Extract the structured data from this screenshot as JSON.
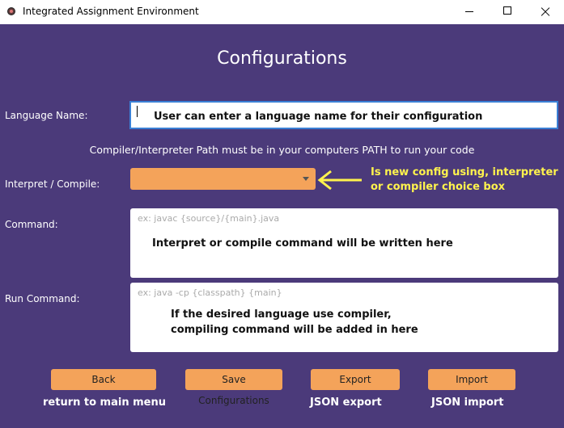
{
  "window": {
    "title": "Integrated Assignment Environment"
  },
  "page": {
    "heading": "Configurations",
    "path_note": "Compiler/Interpreter Path must be in your computers PATH to run your code"
  },
  "labels": {
    "language_name": "Language Name:",
    "interpret_compile": "Interpret / Compile:",
    "command": "Command:",
    "run_command": "Run Command:"
  },
  "fields": {
    "language_name_value": "",
    "interpret_compile_selected": "",
    "command_placeholder": "ex: javac {source}/{main}.java",
    "run_command_placeholder": "ex: java -cp {classpath} {main}"
  },
  "buttons": {
    "back": "Back",
    "save": "Save Configurations",
    "export": "Export",
    "import": "Import"
  },
  "annotations": {
    "language_name": "User can enter a language name for their configuration",
    "interpret_compile": "Is new config using, interpreter\nor compiler choice box",
    "command": "Interpret or compile command will be written here",
    "run_command": "If the desired language use compiler,\ncompiling command will be added in here",
    "back": "return to main menu",
    "export": "JSON export",
    "import": "JSON import"
  },
  "colors": {
    "background": "#4b3a7a",
    "button": "#f4a35a",
    "annotation_yellow": "#fff34d",
    "focus_border": "#3a7fd5"
  }
}
